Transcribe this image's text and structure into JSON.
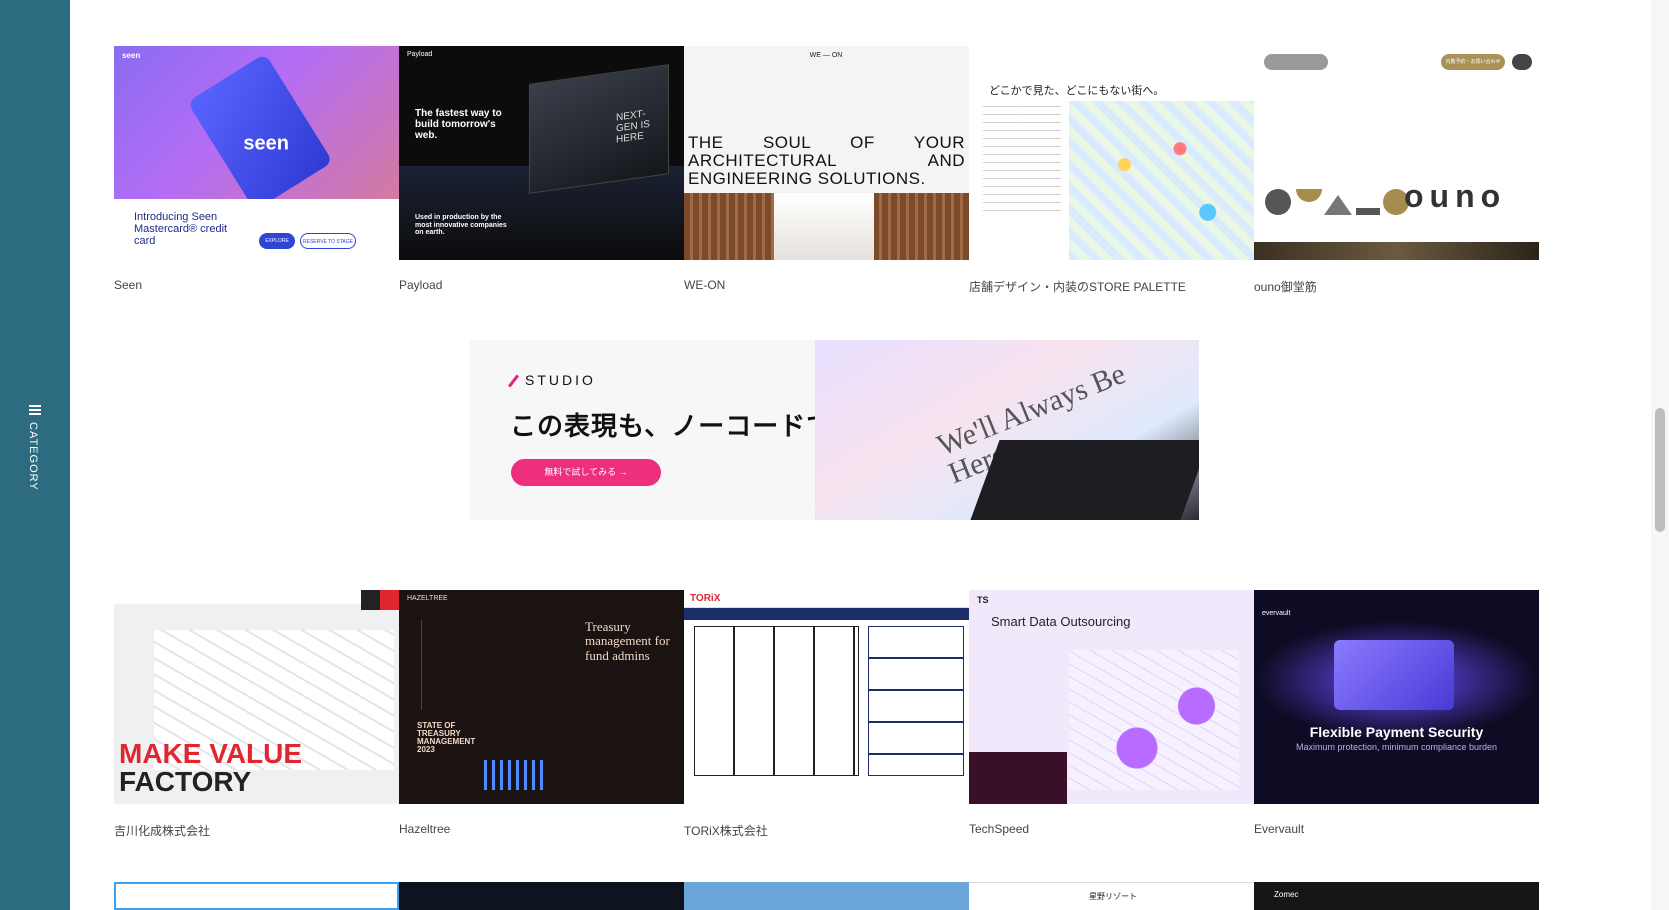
{
  "sidebar": {
    "category_label": "CATEGORY"
  },
  "row1": [
    {
      "title": "Seen",
      "thumb": {
        "logo": "seen",
        "card_text": "seen",
        "headline": "Introducing Seen Mastercard® credit card",
        "btn1": "EXPLORE",
        "btn2": "RESERVE TO STAGE"
      }
    },
    {
      "title": "Payload",
      "thumb": {
        "logo": "Payload",
        "headline": "The fastest way to build tomorrow's web.",
        "screen_text": "NEXT-GEN IS HERE",
        "footer": "Used in production by the most innovative companies on earth."
      }
    },
    {
      "title": "WE-ON",
      "thumb": {
        "logo": "WE — ON",
        "headline": "THE SOUL OF YOUR ARCHITECTURAL AND ENGINEERING SOLUTIONS."
      }
    },
    {
      "title": "店舗デザイン・内装のSTORE PALETTE",
      "thumb": {
        "headline": "どこかで見た、どこにもない街へ。"
      }
    },
    {
      "title": "ouno御堂筋",
      "thumb": {
        "logo": "ouno",
        "btn": "内覧予約・お問い合わせ"
      }
    }
  ],
  "banner": {
    "logo": "STUDIO",
    "copy": "この表現も、ノーコードで。",
    "cta": "無料で試してみる →",
    "art_text": "We'll Always Be Here."
  },
  "row2": [
    {
      "title": "吉川化成株式会社",
      "thumb": {
        "headline1": "MAKE VALUE",
        "headline2": "FACTORY"
      }
    },
    {
      "title": "Hazeltree",
      "thumb": {
        "logo": "HAZELTREE",
        "headline": "Treasury management for fund admins",
        "report": "STATE OF TREASURY MANAGEMENT 2023"
      }
    },
    {
      "title": "TORiX株式会社",
      "thumb": {
        "logo": "TORiX"
      }
    },
    {
      "title": "TechSpeed",
      "thumb": {
        "logo": "TS",
        "headline": "Smart Data Outsourcing"
      }
    },
    {
      "title": "Evervault",
      "thumb": {
        "logo": "evervault",
        "headline": "Flexible Payment Security",
        "sub": "Maximum protection, minimum compliance burden"
      }
    }
  ],
  "row3": [
    {
      "text": ""
    },
    {
      "text": ""
    },
    {
      "text": ""
    },
    {
      "text": "星野リゾート"
    },
    {
      "text": "Zomec"
    }
  ],
  "colors": {
    "sidebar": "#2c6b80",
    "cta_pink": "#ee2f7d",
    "make_value_red": "#e0262f"
  }
}
